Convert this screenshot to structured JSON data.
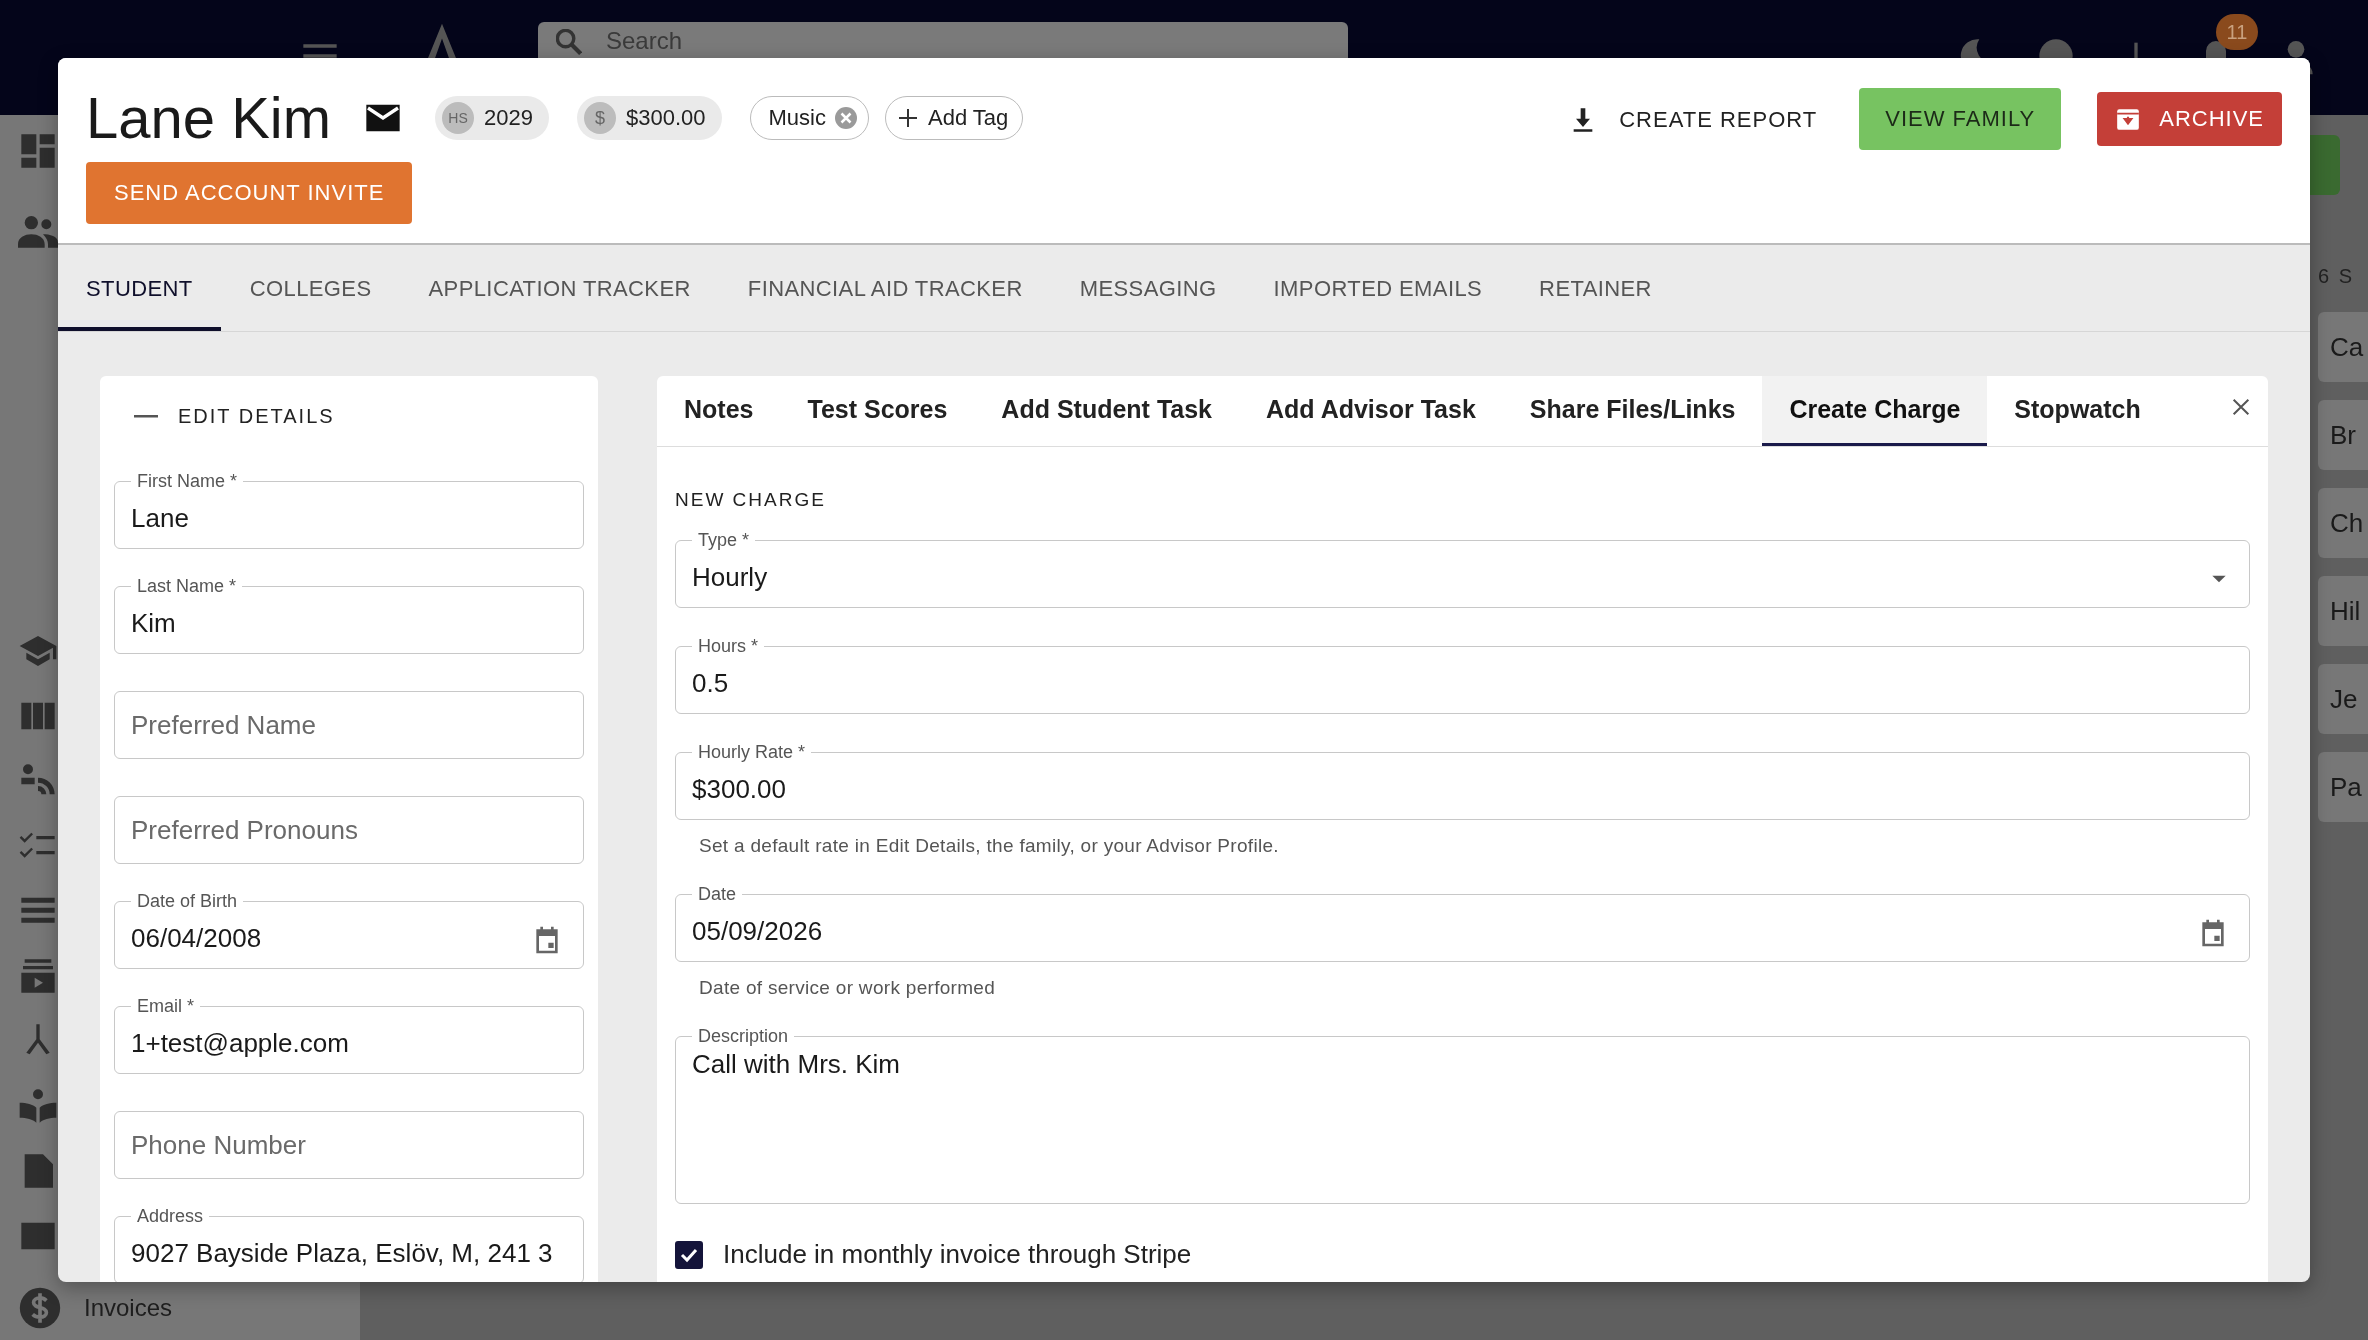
{
  "topbar": {
    "search": {
      "placeholder": "Search"
    },
    "notification_count": "11"
  },
  "sidebar": {
    "items": [
      {
        "label": "Invoices"
      }
    ]
  },
  "side_list": {
    "header": "6 S",
    "items": [
      "Ca",
      "Br",
      "Ch",
      "Hil",
      "Je",
      "Pa"
    ]
  },
  "student": {
    "name": "Lane Kim",
    "chips": [
      {
        "kind": "grade",
        "prefix": "HS",
        "label": "2029"
      },
      {
        "kind": "balance",
        "prefix": "$",
        "label": "$300.00"
      }
    ],
    "tags": [
      {
        "label": "Music"
      }
    ],
    "add_tag": "Add Tag",
    "invite_button": "SEND ACCOUNT INVITE",
    "actions": {
      "report": "CREATE REPORT",
      "family": "VIEW FAMILY",
      "archive": "ARCHIVE"
    }
  },
  "tabs": [
    {
      "label": "STUDENT",
      "selected": true
    },
    {
      "label": "COLLEGES",
      "selected": false
    },
    {
      "label": "APPLICATION TRACKER",
      "selected": false
    },
    {
      "label": "FINANCIAL AID TRACKER",
      "selected": false
    },
    {
      "label": "MESSAGING",
      "selected": false
    },
    {
      "label": "IMPORTED EMAILS",
      "selected": false
    },
    {
      "label": "RETAINER",
      "selected": false
    }
  ],
  "details": {
    "title": "EDIT DETAILS",
    "fields": [
      {
        "kind": "text",
        "label": "First Name *",
        "value": "Lane"
      },
      {
        "kind": "text",
        "label": "Last Name *",
        "value": "Kim"
      },
      {
        "kind": "text",
        "placeholder": "Preferred Name"
      },
      {
        "kind": "text",
        "placeholder": "Preferred Pronouns"
      },
      {
        "kind": "date",
        "label": "Date of Birth",
        "value": "06/04/2008"
      },
      {
        "kind": "text",
        "label": "Email *",
        "value": "1+test@apple.com"
      },
      {
        "kind": "text",
        "placeholder": "Phone Number"
      },
      {
        "kind": "text",
        "label": "Address",
        "value": "9027 Bayside Plaza, Eslöv, M, 241 3"
      }
    ]
  },
  "charge_tabs": [
    {
      "label": "Notes",
      "selected": false
    },
    {
      "label": "Test Scores",
      "selected": false
    },
    {
      "label": "Add Student Task",
      "selected": false
    },
    {
      "label": "Add Advisor Task",
      "selected": false
    },
    {
      "label": "Share Files/Links",
      "selected": false
    },
    {
      "label": "Create Charge",
      "selected": true
    },
    {
      "label": "Stopwatch",
      "selected": false
    }
  ],
  "charge": {
    "title": "NEW CHARGE",
    "fields": [
      {
        "kind": "select",
        "label": "Type *",
        "value": "Hourly"
      },
      {
        "kind": "text",
        "label": "Hours *",
        "value": "0.5"
      },
      {
        "kind": "text",
        "label": "Hourly Rate *",
        "value": "$300.00",
        "hint": "Set a default rate in Edit Details, the family, or your Advisor Profile."
      },
      {
        "kind": "date",
        "label": "Date",
        "value": "05/09/2026",
        "hint": "Date of service or work performed"
      },
      {
        "kind": "textarea",
        "label": "Description",
        "value": "Call with Mrs. Kim"
      }
    ],
    "invoice_checkbox": {
      "label": "Include in monthly invoice through Stripe",
      "checked": true
    }
  }
}
